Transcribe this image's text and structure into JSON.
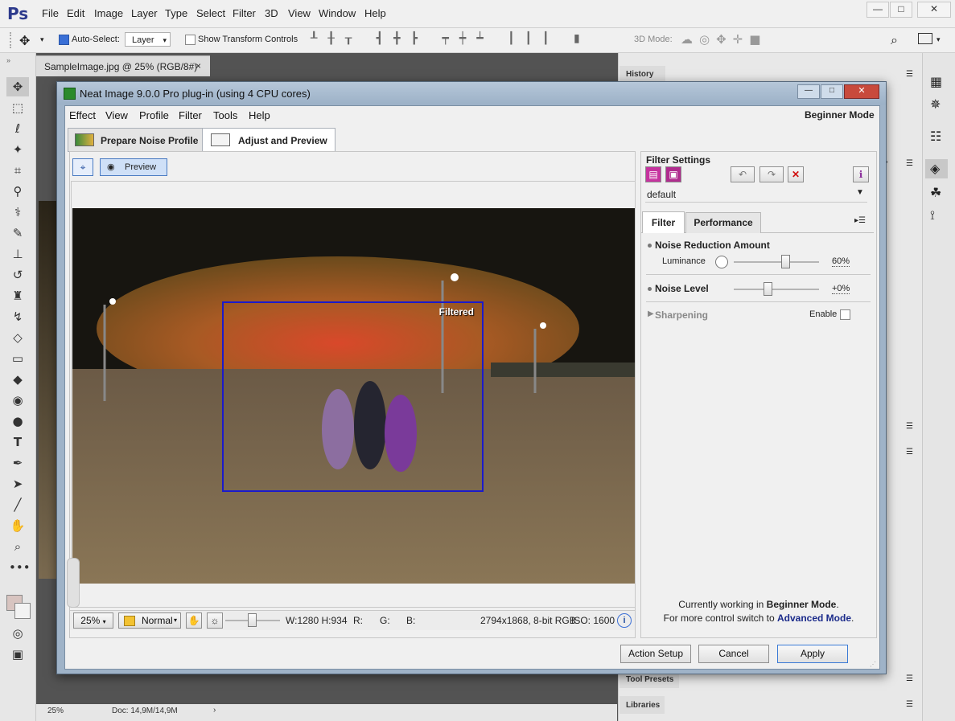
{
  "app": {
    "logo": "Ps"
  },
  "ps_menu": [
    "File",
    "Edit",
    "Image",
    "Layer",
    "Type",
    "Select",
    "Filter",
    "3D",
    "View",
    "Window",
    "Help"
  ],
  "ps_options": {
    "auto_select_label": "Auto-Select:",
    "auto_select_value": "Layer",
    "show_transform_label": "Show Transform Controls",
    "mode_3d_label": "3D Mode:"
  },
  "ps_doc_tab": {
    "label": "SampleImage.jpg @ 25% (RGB/8#)",
    "close": "×"
  },
  "ps_status": {
    "zoom": "25%",
    "doc": "Doc: 14,9M/14,9M"
  },
  "ps_panels": {
    "history": "History",
    "tool_presets": "Tool Presets",
    "libraries": "Libraries"
  },
  "dialog": {
    "title": "Neat Image 9.0.0 Pro plug-in (using 4 CPU cores)",
    "menu": [
      "Effect",
      "View",
      "Profile",
      "Filter",
      "Tools",
      "Help"
    ],
    "mode_label": "Beginner Mode",
    "tabs": [
      {
        "label": "Prepare Noise Profile",
        "active": false
      },
      {
        "label": "Adjust and Preview",
        "active": true
      }
    ],
    "preview_button": "Preview",
    "filtered_label": "Filtered",
    "status": {
      "zoom": "25%",
      "blend_mode": "Normal",
      "size": "W:1280 H:934",
      "r": "R:",
      "g": "G:",
      "b": "B:",
      "image_info": "2794x1868, 8-bit RGB",
      "iso": "ISO: 1600"
    },
    "filter_settings": {
      "header": "Filter Settings",
      "preset": "default",
      "tabs": [
        "Filter",
        "Performance"
      ],
      "noise_reduction_amount": "Noise Reduction Amount",
      "luminance_label": "Luminance",
      "luminance_value": "60%",
      "luminance_fraction": 0.6,
      "noise_level_label": "Noise Level",
      "noise_level_value": "+0%",
      "noise_level_fraction": 0.4,
      "sharpening_label": "Sharpening",
      "enable_label": "Enable"
    },
    "mode_info": {
      "line1_prefix": "Currently working in ",
      "line1_mode": "Beginner Mode",
      "line1_suffix": ".",
      "line2_prefix": "For more control switch to ",
      "line2_link": "Advanced Mode",
      "line2_suffix": "."
    },
    "buttons": {
      "action_setup": "Action Setup",
      "cancel": "Cancel",
      "apply": "Apply"
    }
  }
}
